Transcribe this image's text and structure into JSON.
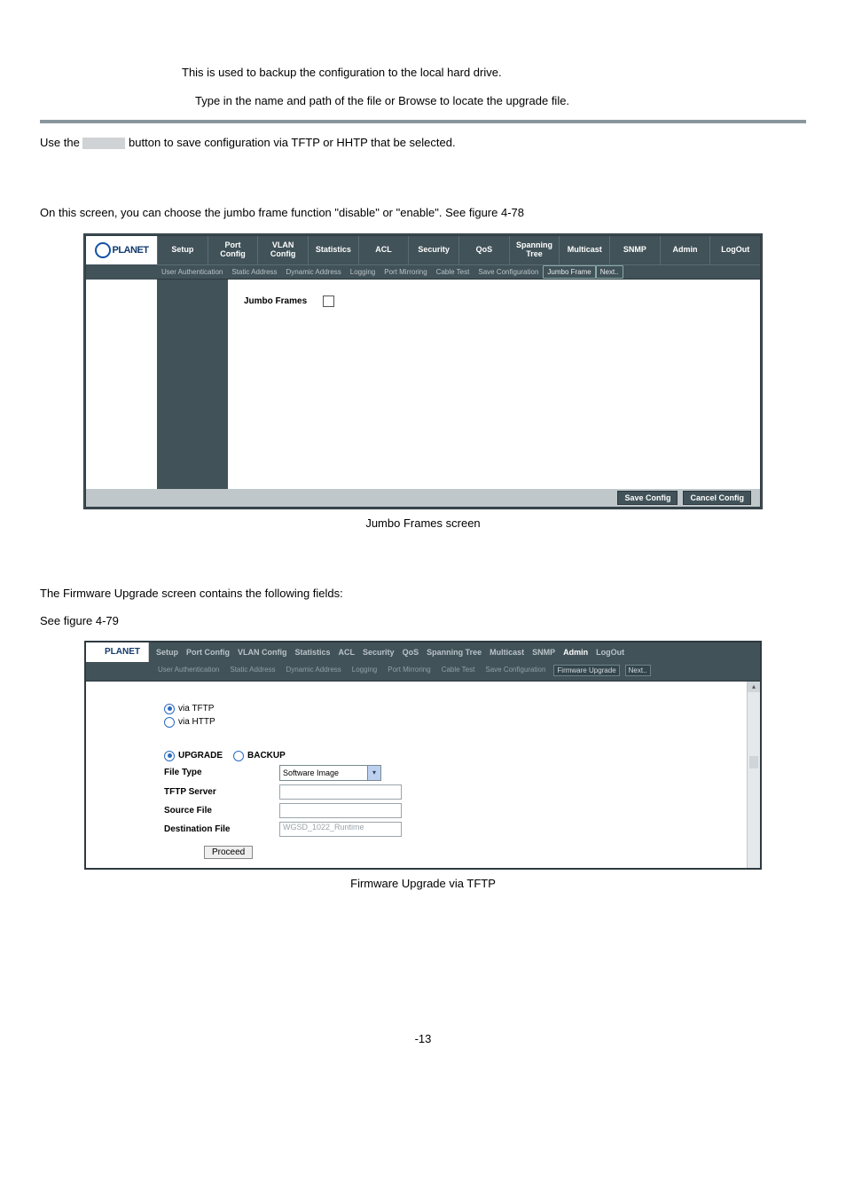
{
  "intro": {
    "line1": "This is used to backup the configuration to the local hard drive.",
    "line2": "Type in the name and path of the file or Browse to locate the upgrade file.",
    "use_the": "Use the ",
    "after_btn": " button to save configuration via TFTP or HHTP that be selected."
  },
  "jumbo": {
    "intro": "On this screen, you can choose the jumbo frame function \"disable\" or \"enable\". See figure 4-78",
    "logo": "PLANET",
    "menu": [
      "Setup",
      "Port Config",
      "VLAN Config",
      "Statistics",
      "ACL",
      "Security",
      "QoS",
      "Spanning Tree",
      "Multicast",
      "SNMP",
      "Admin",
      "LogOut"
    ],
    "submenu": [
      "User Authentication",
      "Static Address",
      "Dynamic Address",
      "Logging",
      "Port Mirroring",
      "Cable Test",
      "Save Configuration",
      "Jumbo Frame",
      "Next.."
    ],
    "label": "Jumbo Frames",
    "footer": {
      "save": "Save Config",
      "cancel": "Cancel Config"
    },
    "caption": "Jumbo Frames screen"
  },
  "fw": {
    "intro1": "The Firmware Upgrade screen contains the following fields:",
    "intro2": "See figure 4-79",
    "logo": "PLANET",
    "menu": [
      "Setup",
      "Port Config",
      "VLAN Config",
      "Statistics",
      "ACL",
      "Security",
      "QoS",
      "Spanning Tree",
      "Multicast",
      "SNMP",
      "Admin",
      "LogOut"
    ],
    "submenu": [
      "User Authentication",
      "Static Address",
      "Dynamic Address",
      "Logging",
      "Port Mirroring",
      "Cable Test",
      "Save Configuration",
      "Firmware Upgrade",
      "Next.."
    ],
    "radios": {
      "tftp": "via TFTP",
      "http": "via HTTP"
    },
    "mode": {
      "upgrade": "UPGRADE",
      "backup": "BACKUP"
    },
    "fields": {
      "file_type_label": "File Type",
      "file_type_value": "Software Image",
      "tftp_server_label": "TFTP Server",
      "source_file_label": "Source File",
      "dest_file_label": "Destination File",
      "dest_file_value": "WGSD_1022_Runtime"
    },
    "proceed": "Proceed",
    "caption": "Firmware Upgrade via TFTP"
  },
  "page_number": "-13"
}
